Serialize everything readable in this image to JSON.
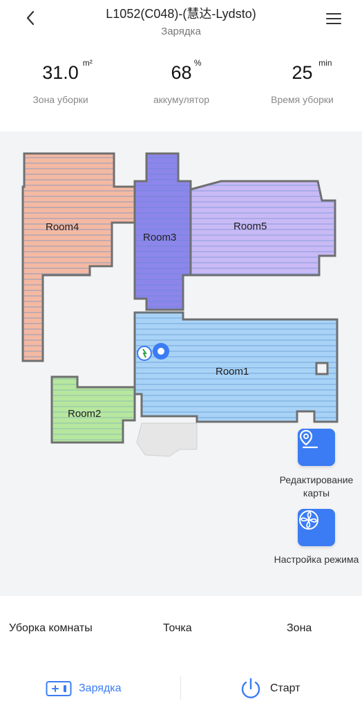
{
  "header": {
    "title": "L1052(C048)-(慧达-Lydsto)",
    "status": "Зарядка"
  },
  "stats": [
    {
      "value": "31.0",
      "unit": "m²",
      "label": "Зона уборки"
    },
    {
      "value": "68",
      "unit": "%",
      "label": "аккумулятор"
    },
    {
      "value": "25",
      "unit": "min",
      "label": "Время уборки"
    }
  ],
  "map": {
    "rooms": [
      {
        "name": "Room4",
        "color": "#f4b9a3"
      },
      {
        "name": "Room3",
        "color": "#8d86ea"
      },
      {
        "name": "Room5",
        "color": "#c9b9f5"
      },
      {
        "name": "Room1",
        "color": "#a9d3f6"
      },
      {
        "name": "Room2",
        "color": "#b7e69e"
      }
    ],
    "actions": {
      "edit_map_label": "Редактирование карты",
      "mode_settings_label": "Настройка режима"
    }
  },
  "modes": {
    "room": "Уборка комнаты",
    "spot": "Точка",
    "zone": "Зона"
  },
  "bottom": {
    "charge_label": "Зарядка",
    "start_label": "Старт"
  },
  "colors": {
    "accent": "#3b7cf4",
    "wall": "#6f6f6f"
  }
}
